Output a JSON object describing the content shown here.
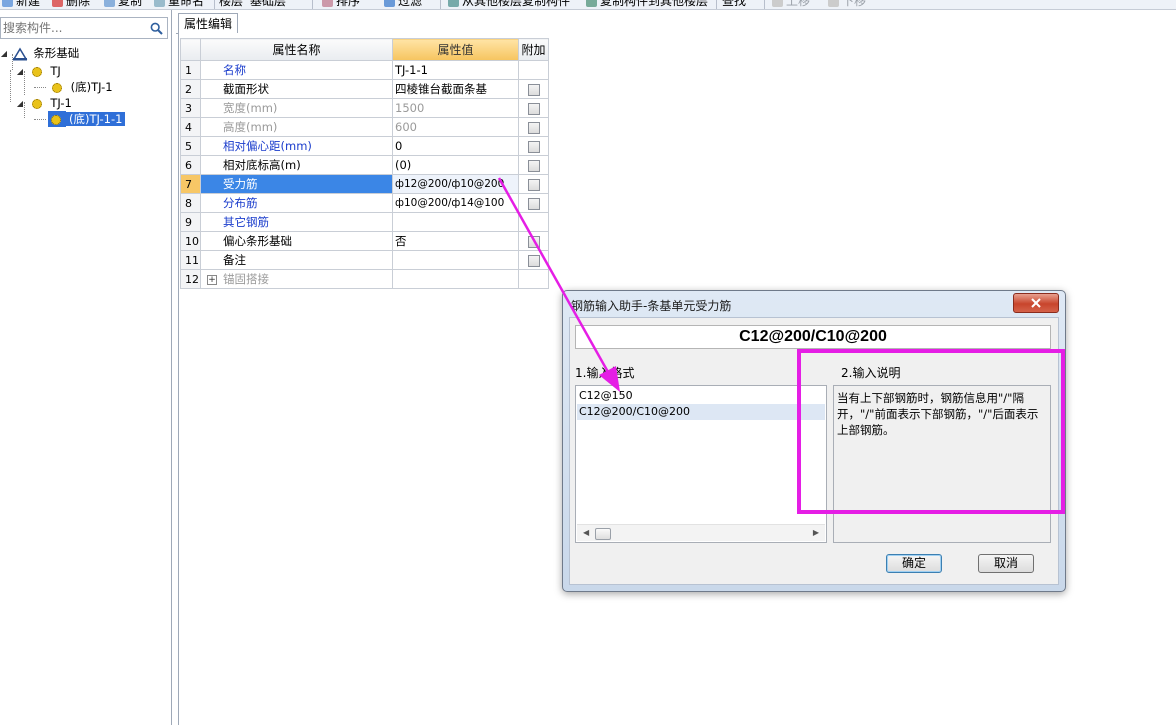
{
  "toolbar": {
    "items": [
      "新建",
      "删除",
      "复制",
      "重命名",
      "楼层",
      "基础层",
      "排序",
      "过滤",
      "从其他楼层复制构件",
      "复制构件到其他楼层",
      "查找",
      "上移",
      "下移"
    ]
  },
  "search": {
    "placeholder": "搜索构件..."
  },
  "tree": {
    "root": "条形基础",
    "group1": "TJ",
    "group1_child": "(底)TJ-1",
    "group2": "TJ-1",
    "group2_child": "(底)TJ-1-1"
  },
  "prop_panel": {
    "tab": "属性编辑",
    "col_name": "属性名称",
    "col_value": "属性值",
    "col_extra": "附加",
    "rows": [
      {
        "no": "1",
        "name": "名称",
        "value": "TJ-1-1"
      },
      {
        "no": "2",
        "name": "截面形状",
        "value": "四棱锥台截面条基"
      },
      {
        "no": "3",
        "name": "宽度(mm)",
        "value": "1500"
      },
      {
        "no": "4",
        "name": "高度(mm)",
        "value": "600"
      },
      {
        "no": "5",
        "name": "相对偏心距(mm)",
        "value": "0"
      },
      {
        "no": "6",
        "name": "相对底标高(m)",
        "value": "(0)"
      },
      {
        "no": "7",
        "name": "受力筋",
        "value": "ф12@200/ф10@200"
      },
      {
        "no": "8",
        "name": "分布筋",
        "value": "ф10@200/ф14@100"
      },
      {
        "no": "9",
        "name": "其它钢筋",
        "value": ""
      },
      {
        "no": "10",
        "name": "偏心条形基础",
        "value": "否"
      },
      {
        "no": "11",
        "name": "备注",
        "value": ""
      },
      {
        "no": "12",
        "name": "锚固搭接",
        "value": ""
      }
    ]
  },
  "dialog": {
    "title": "钢筋输入助手-条基单元受力筋",
    "formula": "C12@200/C10@200",
    "format_label": "1.输入格式",
    "desc_label": "2.输入说明",
    "formats": [
      "C12@150",
      "C12@200/C10@200"
    ],
    "description": "当有上下部钢筋时，钢筋信息用\"/\"隔开，\"/\"前面表示下部钢筋，\"/\"后面表示上部钢筋。",
    "ok_label": "确定",
    "cancel_label": "取消"
  },
  "colors": {
    "annotation": "#e51ee5",
    "selection": "#3b86e6",
    "value_header": "#f6c45f"
  }
}
